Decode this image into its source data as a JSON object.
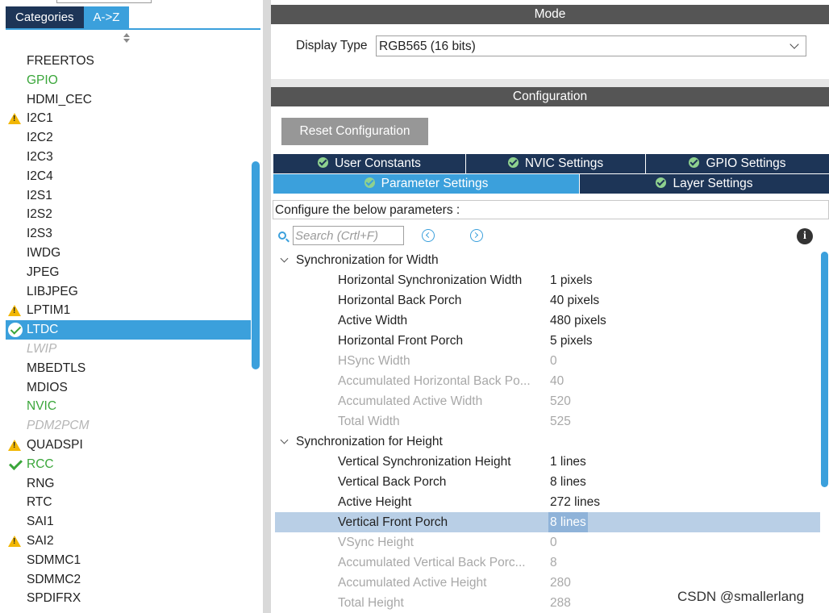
{
  "left_panel": {
    "tabs": [
      {
        "label": "Categories",
        "active": false
      },
      {
        "label": "A->Z",
        "active": true
      }
    ],
    "items": [
      {
        "label": "FREERTOS",
        "state": "normal",
        "icon": ""
      },
      {
        "label": "GPIO",
        "state": "green",
        "icon": ""
      },
      {
        "label": "HDMI_CEC",
        "state": "normal",
        "icon": ""
      },
      {
        "label": "I2C1",
        "state": "normal",
        "icon": "warning-icon"
      },
      {
        "label": "I2C2",
        "state": "normal",
        "icon": ""
      },
      {
        "label": "I2C3",
        "state": "normal",
        "icon": ""
      },
      {
        "label": "I2C4",
        "state": "normal",
        "icon": ""
      },
      {
        "label": "I2S1",
        "state": "normal",
        "icon": ""
      },
      {
        "label": "I2S2",
        "state": "normal",
        "icon": ""
      },
      {
        "label": "I2S3",
        "state": "normal",
        "icon": ""
      },
      {
        "label": "IWDG",
        "state": "normal",
        "icon": ""
      },
      {
        "label": "JPEG",
        "state": "normal",
        "icon": ""
      },
      {
        "label": "LIBJPEG",
        "state": "normal",
        "icon": ""
      },
      {
        "label": "LPTIM1",
        "state": "normal",
        "icon": "warning-icon"
      },
      {
        "label": "LTDC",
        "state": "selected",
        "icon": "check-circle-icon"
      },
      {
        "label": "LWIP",
        "state": "disabled",
        "icon": ""
      },
      {
        "label": "MBEDTLS",
        "state": "normal",
        "icon": ""
      },
      {
        "label": "MDIOS",
        "state": "normal",
        "icon": ""
      },
      {
        "label": "NVIC",
        "state": "green",
        "icon": ""
      },
      {
        "label": "PDM2PCM",
        "state": "disabled",
        "icon": ""
      },
      {
        "label": "QUADSPI",
        "state": "normal",
        "icon": "warning-icon"
      },
      {
        "label": "RCC",
        "state": "green",
        "icon": "check-icon"
      },
      {
        "label": "RNG",
        "state": "normal",
        "icon": ""
      },
      {
        "label": "RTC",
        "state": "normal",
        "icon": ""
      },
      {
        "label": "SAI1",
        "state": "normal",
        "icon": ""
      },
      {
        "label": "SAI2",
        "state": "normal",
        "icon": "warning-icon"
      },
      {
        "label": "SDMMC1",
        "state": "normal",
        "icon": ""
      },
      {
        "label": "SDMMC2",
        "state": "normal",
        "icon": ""
      },
      {
        "label": "SPDIFRX",
        "state": "normal",
        "icon": ""
      }
    ]
  },
  "mode": {
    "header": "Mode",
    "display_type_label": "Display Type",
    "display_type_value": "RGB565 (16 bits)"
  },
  "configuration": {
    "header": "Configuration",
    "reset_label": "Reset Configuration",
    "tabs_row1": [
      "User Constants",
      "NVIC Settings",
      "GPIO Settings"
    ],
    "tabs_row2": [
      "Parameter Settings",
      "Layer Settings"
    ],
    "active_tab": "Parameter Settings",
    "params_caption": "Configure the below parameters :",
    "search_placeholder": "Search (Crtl+F)",
    "groups": [
      {
        "title": "Synchronization for Width",
        "params": [
          {
            "name": "Horizontal Synchronization Width",
            "value": "1 pixels",
            "readonly": false
          },
          {
            "name": "Horizontal Back Porch",
            "value": "40 pixels",
            "readonly": false
          },
          {
            "name": "Active Width",
            "value": "480 pixels",
            "readonly": false
          },
          {
            "name": "Horizontal Front Porch",
            "value": "5 pixels",
            "readonly": false
          },
          {
            "name": "HSync Width",
            "value": "0",
            "readonly": true
          },
          {
            "name": "Accumulated Horizontal Back Po...",
            "value": "40",
            "readonly": true
          },
          {
            "name": "Accumulated Active Width",
            "value": "520",
            "readonly": true
          },
          {
            "name": "Total Width",
            "value": "525",
            "readonly": true
          }
        ]
      },
      {
        "title": "Synchronization for Height",
        "params": [
          {
            "name": "Vertical Synchronization Height",
            "value": "1 lines",
            "readonly": false
          },
          {
            "name": "Vertical Back Porch",
            "value": "8 lines",
            "readonly": false
          },
          {
            "name": "Active Height",
            "value": "272 lines",
            "readonly": false
          },
          {
            "name": "Vertical Front Porch",
            "value": "8 lines",
            "readonly": false,
            "selected": true
          },
          {
            "name": "VSync Height",
            "value": "0",
            "readonly": true
          },
          {
            "name": "Accumulated Vertical Back Porc...",
            "value": "8",
            "readonly": true
          },
          {
            "name": "Accumulated Active Height",
            "value": "280",
            "readonly": true
          },
          {
            "name": "Total Height",
            "value": "288",
            "readonly": true
          }
        ]
      }
    ]
  },
  "watermark": "CSDN @smallerlang",
  "colors": {
    "accent": "#3ba0dc",
    "navy": "#1d3557",
    "header_gray": "#555555",
    "enabled_green": "#3aa63a",
    "warning_yellow": "#f2b705",
    "selection_row": "#b9cfe6"
  }
}
